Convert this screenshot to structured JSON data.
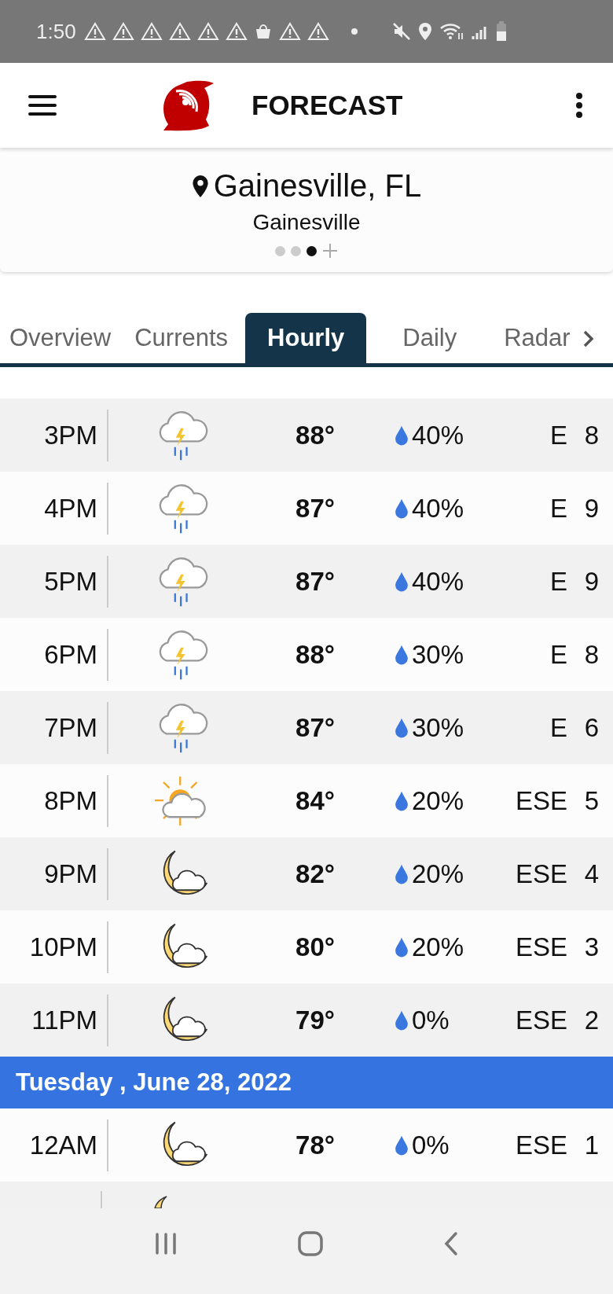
{
  "status_bar": {
    "time": "1:50"
  },
  "app_bar": {
    "title": "FORECAST"
  },
  "location": {
    "name": "Gainesville, FL",
    "station": "Gainesville",
    "page_dots": [
      {
        "selected": false
      },
      {
        "selected": false
      },
      {
        "selected": true
      }
    ]
  },
  "tabs": [
    {
      "label": "Overview",
      "selected": false
    },
    {
      "label": "Currents",
      "selected": false
    },
    {
      "label": "Hourly",
      "selected": true
    },
    {
      "label": "Daily",
      "selected": false
    },
    {
      "label": "Radar",
      "selected": false
    }
  ],
  "hours": [
    {
      "time": "3PM",
      "kind": "storm",
      "temp": "88°",
      "precip": "40%",
      "wind_dir": "E",
      "wind_speed": "8"
    },
    {
      "time": "4PM",
      "kind": "storm",
      "temp": "87°",
      "precip": "40%",
      "wind_dir": "E",
      "wind_speed": "9"
    },
    {
      "time": "5PM",
      "kind": "storm",
      "temp": "87°",
      "precip": "40%",
      "wind_dir": "E",
      "wind_speed": "9"
    },
    {
      "time": "6PM",
      "kind": "storm",
      "temp": "88°",
      "precip": "30%",
      "wind_dir": "E",
      "wind_speed": "8"
    },
    {
      "time": "7PM",
      "kind": "storm",
      "temp": "87°",
      "precip": "30%",
      "wind_dir": "E",
      "wind_speed": "6"
    },
    {
      "time": "8PM",
      "kind": "partly-sunny",
      "temp": "84°",
      "precip": "20%",
      "wind_dir": "ESE",
      "wind_speed": "5"
    },
    {
      "time": "9PM",
      "kind": "night-cloudy",
      "temp": "82°",
      "precip": "20%",
      "wind_dir": "ESE",
      "wind_speed": "4"
    },
    {
      "time": "10PM",
      "kind": "night-cloudy",
      "temp": "80°",
      "precip": "20%",
      "wind_dir": "ESE",
      "wind_speed": "3"
    },
    {
      "time": "11PM",
      "kind": "night-cloudy",
      "temp": "79°",
      "precip": "0%",
      "wind_dir": "ESE",
      "wind_speed": "2"
    }
  ],
  "day_header": "Tuesday , June 28, 2022",
  "next_day_hours": [
    {
      "time": "12AM",
      "kind": "night-cloudy",
      "temp": "78°",
      "precip": "0%",
      "wind_dir": "ESE",
      "wind_speed": "1"
    }
  ],
  "partial_row": {
    "kind": "night-cloudy"
  }
}
